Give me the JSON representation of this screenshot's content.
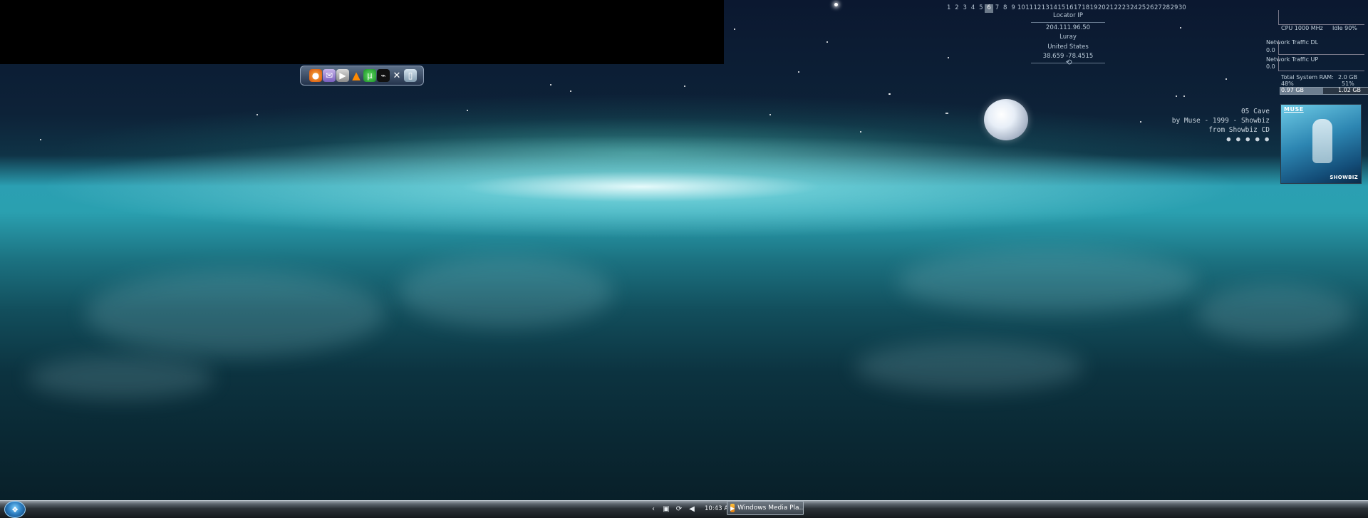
{
  "desktop": {
    "calendar_days": [
      "1",
      "2",
      "3",
      "4",
      "5",
      "6",
      "7",
      "8",
      "9",
      "10",
      "11",
      "12",
      "13",
      "14",
      "15",
      "16",
      "17",
      "18",
      "19",
      "20",
      "21",
      "22",
      "23",
      "24",
      "25",
      "26",
      "27",
      "28",
      "29",
      "30"
    ],
    "current_day": "6",
    "locator": {
      "title": "Locator IP",
      "ip": "204.111.96.50",
      "city": "Luray",
      "country": "United States",
      "coords": "38.659 -78.4515"
    },
    "system_monitor": {
      "cpu_label": "CPU 1000 MHz",
      "idle_label": "Idle 90%",
      "net_dl_label": "Network Traffic DL",
      "net_dl_value": "0.0",
      "net_up_label": "Network Traffic UP",
      "net_up_value": "0.0",
      "ram_label": "Total System RAM:",
      "ram_total": "2.0 GB",
      "ram_used_pct": "48%",
      "ram_free_pct": "51%",
      "ram_used": "0.97 GB",
      "ram_free": "1.02 GB"
    },
    "now_playing": {
      "track": "05 Cave",
      "artist_line": "by Muse - 1999 - Showbiz",
      "source_line": "from Showbiz CD",
      "rating": "● ● ● ● ●"
    },
    "album_art": {
      "artist": "MUSE",
      "title": "SHOWBIZ"
    },
    "dock_icons": [
      "firefox-icon",
      "messenger-icon",
      "media-player-icon",
      "vlc-icon",
      "utorrent-icon",
      "steam-icon",
      "tools-icon",
      "recycle-bin-icon"
    ]
  },
  "taskbar": {
    "clock": "10:43 AM",
    "tasks": [
      {
        "label": "Windows Media Pla..."
      }
    ]
  },
  "colors": {
    "accent": "#2aa0b0",
    "taskbar": "#2c3238"
  }
}
